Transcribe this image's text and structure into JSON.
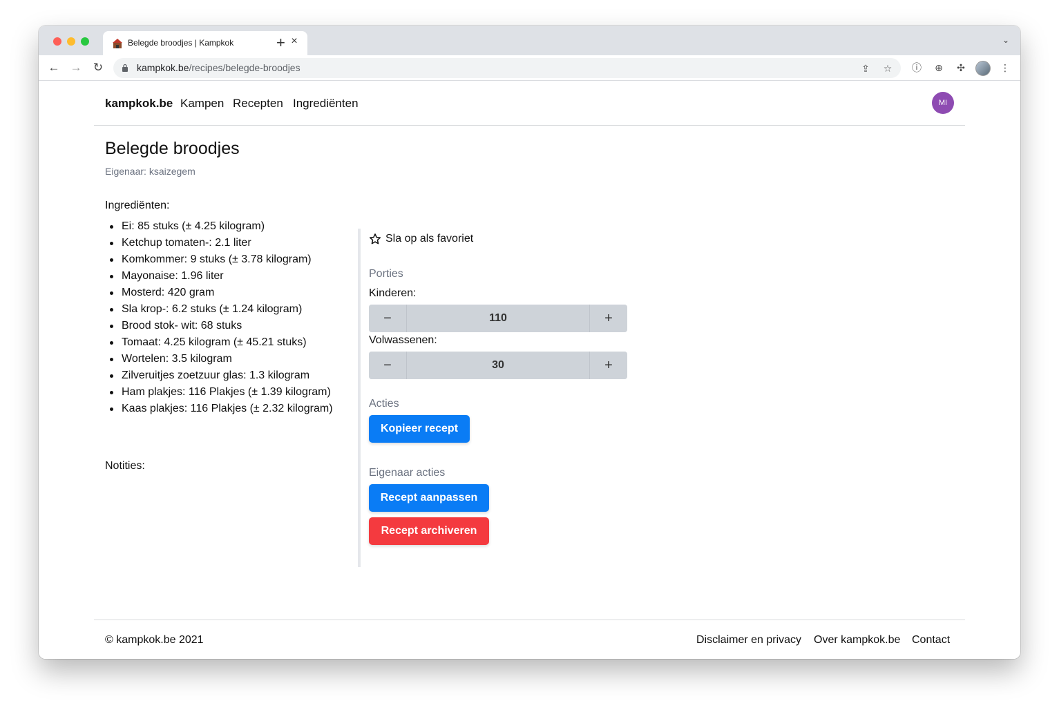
{
  "browser": {
    "tab_title": "Belegde broodjes | Kampkok",
    "tab_close": "×",
    "new_tab": "+",
    "url_host": "kampkok.be",
    "url_path": "/recipes/belegde-broodjes"
  },
  "nav": {
    "brand": "kampkok.be",
    "links": [
      "Kampen",
      "Recepten",
      "Ingrediënten"
    ],
    "avatar_initials": "MI"
  },
  "recipe": {
    "title": "Belegde broodjes",
    "owner": "Eigenaar: ksaizegem",
    "ingredients_heading": "Ingrediënten:",
    "ingredients": [
      "Ei: 85 stuks (± 4.25 kilogram)",
      "Ketchup tomaten-: 2.1 liter",
      "Komkommer: 9 stuks (± 3.78 kilogram)",
      "Mayonaise: 1.96 liter",
      "Mosterd: 420 gram",
      "Sla krop-: 6.2 stuks (± 1.24 kilogram)",
      "Brood stok- wit: 68 stuks",
      "Tomaat: 4.25 kilogram (± 45.21 stuks)",
      "Wortelen: 3.5 kilogram",
      "Zilveruitjes zoetzuur glas: 1.3 kilogram",
      "Ham plakjes: 116 Plakjes (± 1.39 kilogram)",
      "Kaas plakjes: 116 Plakjes (± 2.32 kilogram)"
    ],
    "notes_heading": "Notities:"
  },
  "sidebar": {
    "favorite_label": "Sla op als favoriet",
    "portions_heading": "Porties",
    "children_label": "Kinderen:",
    "children_value": "110",
    "adults_label": "Volwassenen:",
    "adults_value": "30",
    "decrement": "−",
    "increment": "+",
    "actions_heading": "Acties",
    "copy_button": "Kopieer recept",
    "owner_actions_heading": "Eigenaar acties",
    "edit_button": "Recept aanpassen",
    "archive_button": "Recept archiveren"
  },
  "footer": {
    "copyright": "© kampkok.be 2021",
    "links": [
      "Disclaimer en privacy",
      "Over kampkok.be",
      "Contact"
    ]
  },
  "colors": {
    "primary": "#0a7cf5",
    "danger": "#f43a3f",
    "avatar": "#8e4bb2",
    "muted": "#6b7280"
  }
}
